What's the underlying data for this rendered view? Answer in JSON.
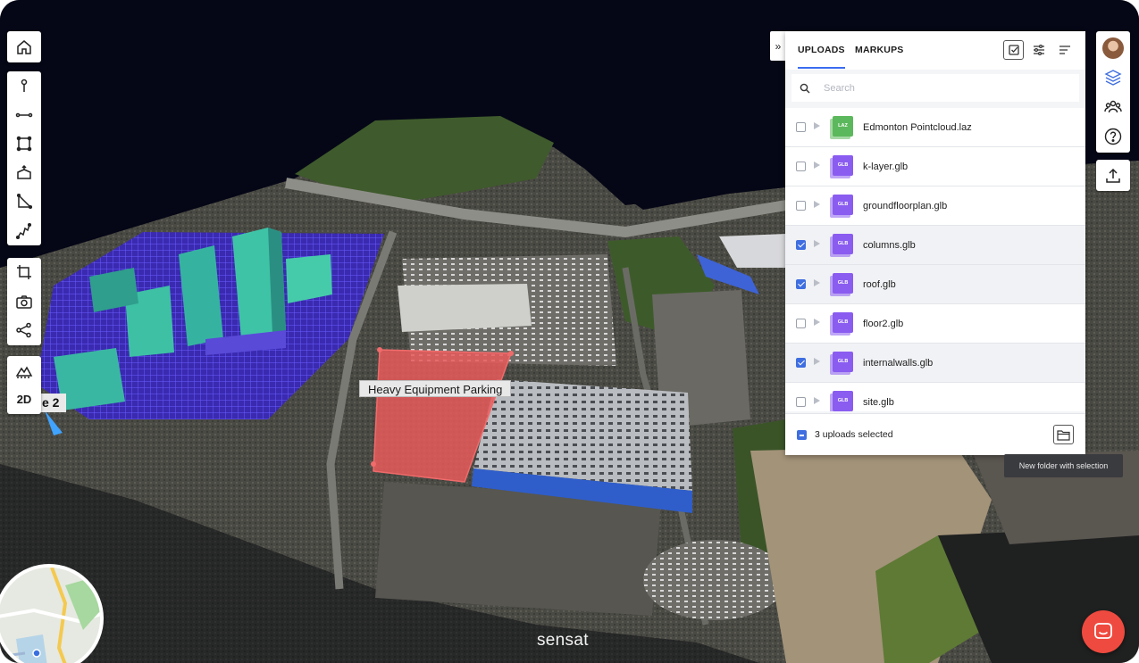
{
  "scene": {
    "area_label": "Heavy Equipment Parking",
    "zone_label": "e 2",
    "brand": "sensat"
  },
  "left_toolbar": {
    "view_mode_label": "2D",
    "tools": [
      "home-icon",
      "pin-icon",
      "line-measure-icon",
      "area-measure-icon",
      "volume-icon",
      "angle-icon",
      "profile-icon",
      "crop-icon",
      "camera-icon",
      "share-icon",
      "terrain-icon"
    ]
  },
  "panel": {
    "tabs": [
      {
        "label": "UPLOADS",
        "active": true
      },
      {
        "label": "MARKUPS",
        "active": false
      }
    ],
    "search_placeholder": "Search",
    "files": [
      {
        "name": "Edmonton Pointcloud.laz",
        "type": "LAZ",
        "checked": false,
        "color": "#5cb85c"
      },
      {
        "name": "k-layer.glb",
        "type": "GLB",
        "checked": false,
        "color": "#8a5cf0"
      },
      {
        "name": "groundfloorplan.glb",
        "type": "GLB",
        "checked": false,
        "color": "#8a5cf0"
      },
      {
        "name": "columns.glb",
        "type": "GLB",
        "checked": true,
        "color": "#8a5cf0"
      },
      {
        "name": "roof.glb",
        "type": "GLB",
        "checked": true,
        "color": "#8a5cf0"
      },
      {
        "name": "floor2.glb",
        "type": "GLB",
        "checked": false,
        "color": "#8a5cf0"
      },
      {
        "name": "internalwalls.glb",
        "type": "GLB",
        "checked": true,
        "color": "#8a5cf0"
      },
      {
        "name": "site.glb",
        "type": "GLB",
        "checked": false,
        "color": "#8a5cf0"
      }
    ],
    "selection_count": "3 uploads selected",
    "tooltip": "New folder with selection"
  },
  "colors": {
    "accent": "#3f6ee0",
    "markup_area": "#e85a5a",
    "chat_button": "#ef4a3f",
    "glb_icon": "#8a5cf0",
    "laz_icon": "#5cb85c"
  }
}
